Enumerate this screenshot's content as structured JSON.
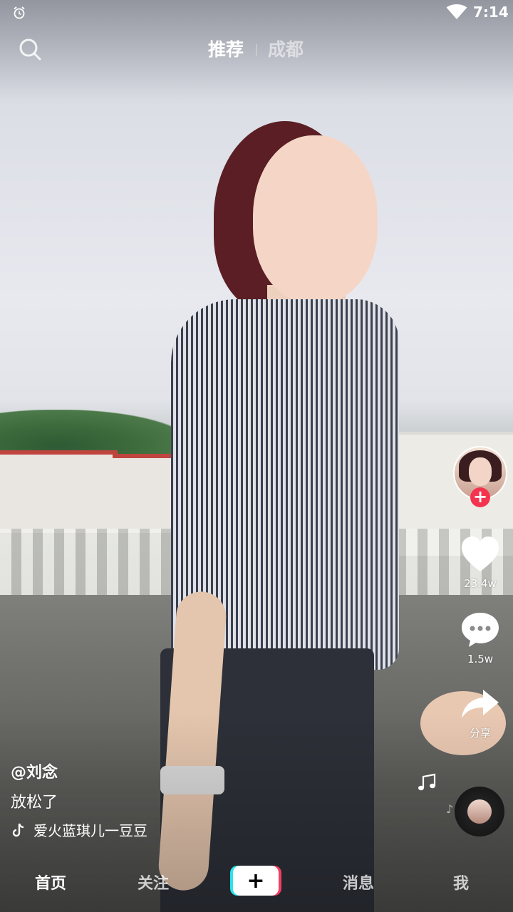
{
  "status_bar": {
    "time": "7:14",
    "icons": [
      "alarm-icon",
      "wifi-icon"
    ]
  },
  "top_nav": {
    "tabs": [
      {
        "label": "推荐",
        "active": true
      },
      {
        "label": "成都",
        "active": false
      }
    ],
    "search_icon": "search-icon"
  },
  "video": {
    "author": "@刘念",
    "caption": "放松了",
    "music": "爱火蓝琪儿一豆豆"
  },
  "actions": {
    "like_count": "23.4w",
    "comment_count": "1.5w",
    "share_label": "分享",
    "follow_plus": "+"
  },
  "bottom_nav": {
    "home": "首页",
    "follow": "关注",
    "create": "+",
    "messages": "消息",
    "me": "我"
  },
  "colors": {
    "accent_red": "#f4344f",
    "cyan": "#2ce3ee",
    "pink": "#f23d63"
  }
}
